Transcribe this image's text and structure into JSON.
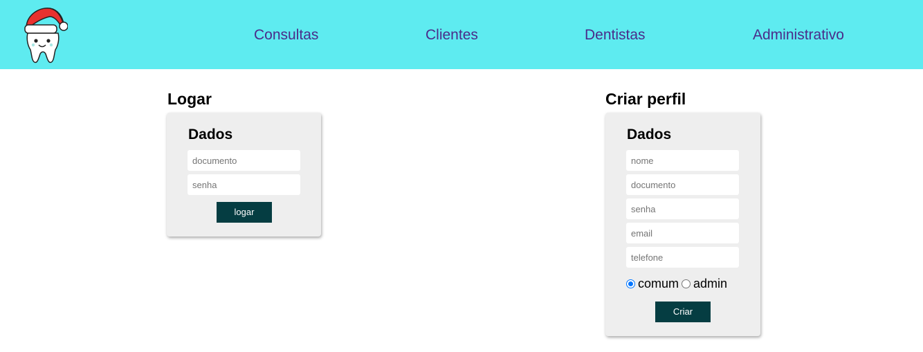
{
  "header": {
    "logo_icon": "tooth-santa-hat-icon",
    "background": "#5eebf0",
    "nav": [
      {
        "label": "Consultas"
      },
      {
        "label": "Clientes"
      },
      {
        "label": "Dentistas"
      },
      {
        "label": "Administrativo"
      }
    ]
  },
  "login": {
    "section_title": "Logar",
    "card_title": "Dados",
    "fields": {
      "documento": {
        "placeholder": "documento",
        "value": ""
      },
      "senha": {
        "placeholder": "senha",
        "value": ""
      }
    },
    "button_label": "logar"
  },
  "signup": {
    "section_title": "Criar perfil",
    "card_title": "Dados",
    "fields": {
      "nome": {
        "placeholder": "nome",
        "value": ""
      },
      "documento": {
        "placeholder": "documento",
        "value": ""
      },
      "senha": {
        "placeholder": "senha",
        "value": ""
      },
      "email": {
        "placeholder": "email",
        "value": ""
      },
      "telefone": {
        "placeholder": "telefone",
        "value": ""
      }
    },
    "role_options": [
      {
        "label": "comum",
        "checked": true
      },
      {
        "label": "admin",
        "checked": false
      }
    ],
    "button_label": "Criar"
  },
  "colors": {
    "nav_text": "#4a2c8a",
    "button_bg": "#053d42",
    "card_bg": "#eeeeee",
    "radio_accent": "#0075ff"
  }
}
